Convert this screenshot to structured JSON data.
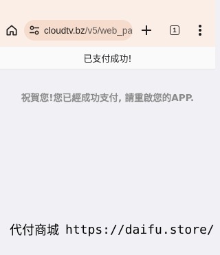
{
  "browser": {
    "url_host": "cloudtv.bz",
    "url_path": "/v5/web_pa",
    "tab_count": "1",
    "icons": {
      "home": "home-icon",
      "site_info": "tune-icon",
      "new_tab": "plus-icon",
      "tabs": "tab-switcher-icon",
      "menu": "more-vert-icon"
    }
  },
  "page": {
    "header_title": "已支付成功!",
    "message": "祝賀您!您已經成功支付, 請重啟您的APP.",
    "footer_brand": "代付商城",
    "footer_url": "https://daifu.store/"
  },
  "colors": {
    "chrome_background": "#fbeee7",
    "url_pill": "#f6dccd",
    "page_background": "#f1f0f5",
    "message_text": "#8a8a8a"
  }
}
